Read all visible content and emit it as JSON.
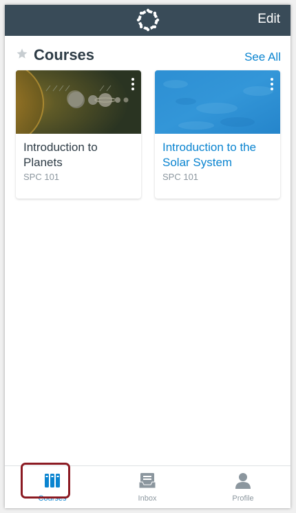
{
  "header": {
    "edit_label": "Edit",
    "bg_color": "#394b58"
  },
  "section": {
    "title": "Courses",
    "see_all_label": "See All",
    "star_icon": "star-icon"
  },
  "courses": [
    {
      "title": "Introduction to Planets",
      "code": "SPC 101",
      "title_color": "#2d3b45",
      "image": "planets-illustration"
    },
    {
      "title": "Introduction to the Solar System",
      "code": "SPC 101",
      "title_color": "#0a84d0",
      "image": "blue-texture"
    }
  ],
  "tabs": [
    {
      "label": "Courses",
      "icon": "courses-icon",
      "active": true
    },
    {
      "label": "Inbox",
      "icon": "inbox-icon",
      "active": false
    },
    {
      "label": "Profile",
      "icon": "profile-icon",
      "active": false
    }
  ],
  "colors": {
    "accent": "#0a84d0",
    "inactive": "#8b969e",
    "highlight": "#8b1a22"
  }
}
